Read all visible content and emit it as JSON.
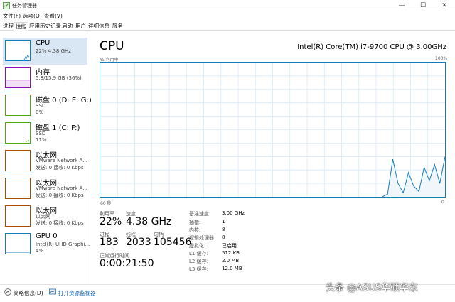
{
  "window": {
    "title": "任务管理器",
    "controls": {
      "minimize": "—",
      "maximize": "☐",
      "close": "✕"
    }
  },
  "menu": [
    "文件(F)",
    "选项(O)",
    "查看(V)"
  ],
  "tabs": [
    {
      "label": "进程",
      "active": false
    },
    {
      "label": "性能",
      "active": true
    },
    {
      "label": "应用历史记录",
      "active": false
    },
    {
      "label": "启动",
      "active": false
    },
    {
      "label": "用户",
      "active": false
    },
    {
      "label": "详细信息",
      "active": false
    },
    {
      "label": "服务",
      "active": false
    }
  ],
  "sidebar": {
    "items": [
      {
        "title": "CPU",
        "line1": "22% 4.38 GHz",
        "line2": "",
        "color": "#117dbb"
      },
      {
        "title": "内存",
        "line1": "5.8/15.9 GB (36%)",
        "line2": "",
        "color": "#8b12ae"
      },
      {
        "title": "磁盘 0 (D: E: G:)",
        "line1": "SSD",
        "line2": "0%",
        "color": "#4da60c"
      },
      {
        "title": "磁盘 1 (C: F:)",
        "line1": "SSD",
        "line2": "11%",
        "color": "#4da60c"
      },
      {
        "title": "以太网",
        "line1": "VMware Network A...",
        "line2": "发送: 0 接收: 0 Kbps",
        "color": "#a74f01"
      },
      {
        "title": "以太网",
        "line1": "VMware Network A...",
        "line2": "发送: 0 接收: 0 Kbps",
        "color": "#a74f01"
      },
      {
        "title": "以太网",
        "line1": "以太网",
        "line2": "发送: 0 接收: 0 Kbps",
        "color": "#a74f01"
      },
      {
        "title": "GPU 0",
        "line1": "Intel(R) UHD Graphi...",
        "line2": "4%",
        "color": "#117dbb"
      }
    ]
  },
  "main": {
    "title": "CPU",
    "model": "Intel(R) Core(TM) i7-9700 CPU @ 3.00GHz",
    "graph": {
      "y_label": "% 利用率",
      "y_max_label": "100%",
      "x_left_label": "60 秒",
      "x_right_label": "0",
      "line_color": "#117dbb",
      "grid_color": "#d9eaf7",
      "utilization": [
        0,
        0,
        0,
        0,
        0,
        0,
        0,
        0,
        0,
        0,
        0,
        0,
        0,
        0,
        0,
        0,
        0,
        0,
        0,
        0,
        0,
        0,
        0,
        0,
        0,
        0,
        0,
        0,
        0,
        0,
        0,
        0,
        0,
        0,
        0,
        0,
        0,
        0,
        0,
        0,
        0,
        0,
        0,
        0,
        0,
        0,
        0,
        0,
        0,
        0,
        0,
        0,
        0,
        0,
        0,
        2,
        28,
        10,
        3,
        18,
        8,
        4,
        22,
        12,
        24,
        10,
        30
      ]
    },
    "stats": {
      "utilization_label": "利用率",
      "utilization": "22%",
      "speed_label": "速度",
      "speed": "4.38 GHz",
      "processes_label": "进程",
      "processes": "183",
      "threads_label": "线程",
      "threads": "2033",
      "handles_label": "句柄",
      "handles": "105456",
      "uptime_label": "正常运行时间",
      "uptime": "0:00:21:50"
    },
    "info": [
      {
        "key": "基准速度:",
        "value": "3.00 GHz"
      },
      {
        "key": "插槽:",
        "value": "1"
      },
      {
        "key": "内核:",
        "value": "8"
      },
      {
        "key": "逻辑处理器:",
        "value": "8"
      },
      {
        "key": "虚拟化:",
        "value": "已启用"
      },
      {
        "key": "L1 缓存:",
        "value": "512 KB"
      },
      {
        "key": "L2 缓存:",
        "value": "2.0 MB"
      },
      {
        "key": "L3 缓存:",
        "value": "12.0 MB"
      }
    ]
  },
  "footer": {
    "brief_label": "简略信息(D)",
    "monitor_label": "打开资源监视器"
  },
  "watermark": "头条 @ASUS华硕华东"
}
